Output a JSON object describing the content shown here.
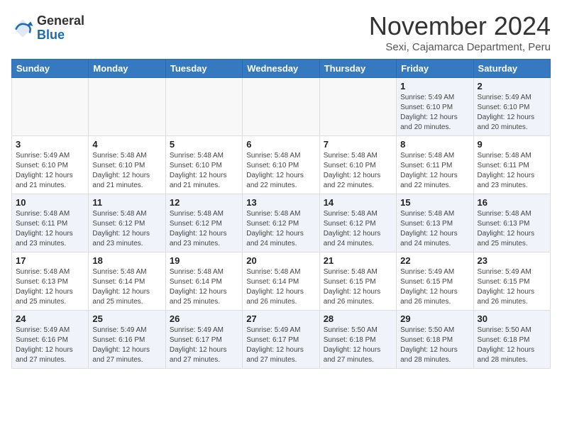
{
  "header": {
    "logo_general": "General",
    "logo_blue": "Blue",
    "month_title": "November 2024",
    "subtitle": "Sexi, Cajamarca Department, Peru"
  },
  "days_of_week": [
    "Sunday",
    "Monday",
    "Tuesday",
    "Wednesday",
    "Thursday",
    "Friday",
    "Saturday"
  ],
  "weeks": [
    [
      {
        "num": "",
        "info": ""
      },
      {
        "num": "",
        "info": ""
      },
      {
        "num": "",
        "info": ""
      },
      {
        "num": "",
        "info": ""
      },
      {
        "num": "",
        "info": ""
      },
      {
        "num": "1",
        "info": "Sunrise: 5:49 AM\nSunset: 6:10 PM\nDaylight: 12 hours and 20 minutes."
      },
      {
        "num": "2",
        "info": "Sunrise: 5:49 AM\nSunset: 6:10 PM\nDaylight: 12 hours and 20 minutes."
      }
    ],
    [
      {
        "num": "3",
        "info": "Sunrise: 5:49 AM\nSunset: 6:10 PM\nDaylight: 12 hours and 21 minutes."
      },
      {
        "num": "4",
        "info": "Sunrise: 5:48 AM\nSunset: 6:10 PM\nDaylight: 12 hours and 21 minutes."
      },
      {
        "num": "5",
        "info": "Sunrise: 5:48 AM\nSunset: 6:10 PM\nDaylight: 12 hours and 21 minutes."
      },
      {
        "num": "6",
        "info": "Sunrise: 5:48 AM\nSunset: 6:10 PM\nDaylight: 12 hours and 22 minutes."
      },
      {
        "num": "7",
        "info": "Sunrise: 5:48 AM\nSunset: 6:10 PM\nDaylight: 12 hours and 22 minutes."
      },
      {
        "num": "8",
        "info": "Sunrise: 5:48 AM\nSunset: 6:11 PM\nDaylight: 12 hours and 22 minutes."
      },
      {
        "num": "9",
        "info": "Sunrise: 5:48 AM\nSunset: 6:11 PM\nDaylight: 12 hours and 23 minutes."
      }
    ],
    [
      {
        "num": "10",
        "info": "Sunrise: 5:48 AM\nSunset: 6:11 PM\nDaylight: 12 hours and 23 minutes."
      },
      {
        "num": "11",
        "info": "Sunrise: 5:48 AM\nSunset: 6:12 PM\nDaylight: 12 hours and 23 minutes."
      },
      {
        "num": "12",
        "info": "Sunrise: 5:48 AM\nSunset: 6:12 PM\nDaylight: 12 hours and 23 minutes."
      },
      {
        "num": "13",
        "info": "Sunrise: 5:48 AM\nSunset: 6:12 PM\nDaylight: 12 hours and 24 minutes."
      },
      {
        "num": "14",
        "info": "Sunrise: 5:48 AM\nSunset: 6:12 PM\nDaylight: 12 hours and 24 minutes."
      },
      {
        "num": "15",
        "info": "Sunrise: 5:48 AM\nSunset: 6:13 PM\nDaylight: 12 hours and 24 minutes."
      },
      {
        "num": "16",
        "info": "Sunrise: 5:48 AM\nSunset: 6:13 PM\nDaylight: 12 hours and 25 minutes."
      }
    ],
    [
      {
        "num": "17",
        "info": "Sunrise: 5:48 AM\nSunset: 6:13 PM\nDaylight: 12 hours and 25 minutes."
      },
      {
        "num": "18",
        "info": "Sunrise: 5:48 AM\nSunset: 6:14 PM\nDaylight: 12 hours and 25 minutes."
      },
      {
        "num": "19",
        "info": "Sunrise: 5:48 AM\nSunset: 6:14 PM\nDaylight: 12 hours and 25 minutes."
      },
      {
        "num": "20",
        "info": "Sunrise: 5:48 AM\nSunset: 6:14 PM\nDaylight: 12 hours and 26 minutes."
      },
      {
        "num": "21",
        "info": "Sunrise: 5:48 AM\nSunset: 6:15 PM\nDaylight: 12 hours and 26 minutes."
      },
      {
        "num": "22",
        "info": "Sunrise: 5:49 AM\nSunset: 6:15 PM\nDaylight: 12 hours and 26 minutes."
      },
      {
        "num": "23",
        "info": "Sunrise: 5:49 AM\nSunset: 6:15 PM\nDaylight: 12 hours and 26 minutes."
      }
    ],
    [
      {
        "num": "24",
        "info": "Sunrise: 5:49 AM\nSunset: 6:16 PM\nDaylight: 12 hours and 27 minutes."
      },
      {
        "num": "25",
        "info": "Sunrise: 5:49 AM\nSunset: 6:16 PM\nDaylight: 12 hours and 27 minutes."
      },
      {
        "num": "26",
        "info": "Sunrise: 5:49 AM\nSunset: 6:17 PM\nDaylight: 12 hours and 27 minutes."
      },
      {
        "num": "27",
        "info": "Sunrise: 5:49 AM\nSunset: 6:17 PM\nDaylight: 12 hours and 27 minutes."
      },
      {
        "num": "28",
        "info": "Sunrise: 5:50 AM\nSunset: 6:18 PM\nDaylight: 12 hours and 27 minutes."
      },
      {
        "num": "29",
        "info": "Sunrise: 5:50 AM\nSunset: 6:18 PM\nDaylight: 12 hours and 28 minutes."
      },
      {
        "num": "30",
        "info": "Sunrise: 5:50 AM\nSunset: 6:18 PM\nDaylight: 12 hours and 28 minutes."
      }
    ]
  ]
}
